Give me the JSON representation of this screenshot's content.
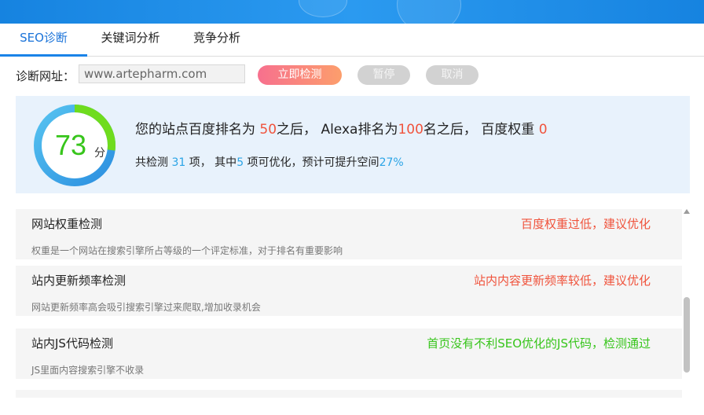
{
  "tabs": [
    {
      "label": "SEO诊断",
      "active": true
    },
    {
      "label": "关键词分析",
      "active": false
    },
    {
      "label": "竞争分析",
      "active": false
    }
  ],
  "url_row": {
    "label": "诊断网址：",
    "value": "www.artepharm.com"
  },
  "buttons": {
    "check": "立即检测",
    "pause": "暂停",
    "cancel": "取消"
  },
  "summary": {
    "score": "73",
    "score_unit": "分",
    "score_fraction": 0.73,
    "line1_a": "您的站点百度排名为 ",
    "baidu_rank": "50",
    "line1_b": "之后，  Alexa排名为",
    "alexa_rank": "100",
    "line1_c": "名之后，  百度权重 ",
    "baidu_weight": "0",
    "line2_a": "共检测 ",
    "total_items": "31",
    "line2_b": " 项， 其中",
    "optimizable": "5",
    "line2_c": " 项可优化，预计可提升空间",
    "improve": "27%"
  },
  "checks": [
    {
      "title": "网站权重检测",
      "desc": "权重是一个网站在搜索引擎所占等级的一个评定标准，对于排名有重要影响",
      "status": "百度权重过低，建议优化",
      "status_type": "warn"
    },
    {
      "title": "站内更新频率检测",
      "desc": "网站更新频率高会吸引搜索引擎过来爬取,增加收录机会",
      "status": "站内内容更新频率较低，建议优化",
      "status_type": "warn"
    },
    {
      "title": "站内JS代码检测",
      "desc": "JS里面内容搜索引擎不收录",
      "status": "首页没有不利SEO优化的JS代码，检测通过",
      "status_type": "pass"
    }
  ],
  "colors": {
    "accent": "#1a83e8",
    "warn": "#f0533c",
    "pass": "#37c51b",
    "highlight": "#2aa4e6"
  },
  "icons": {
    "scroll_up": "triangle-up"
  }
}
